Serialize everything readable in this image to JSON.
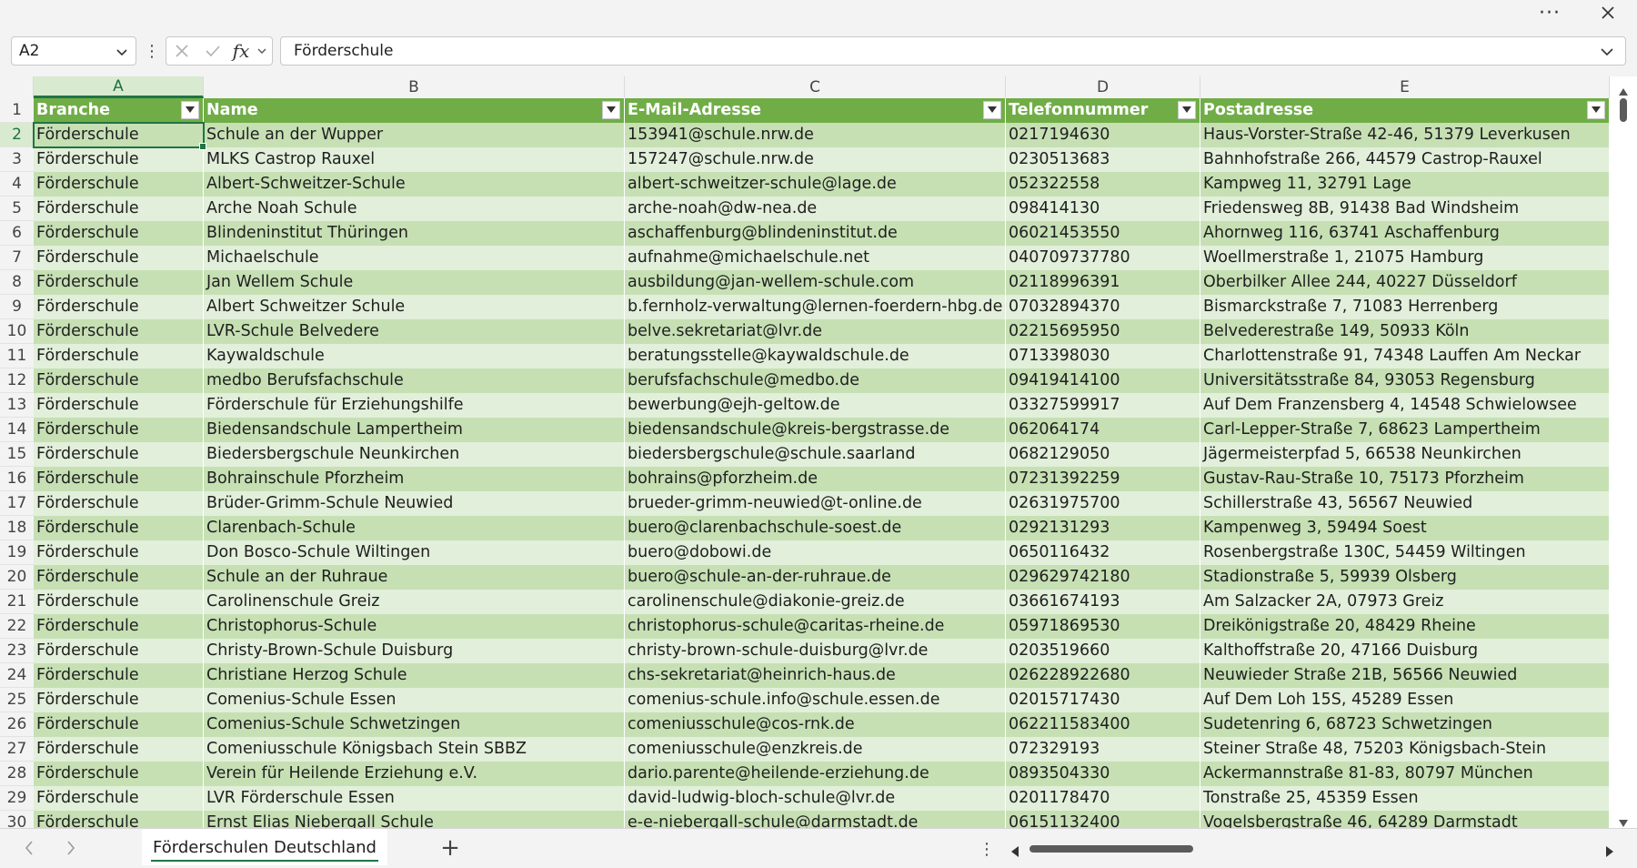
{
  "window": {
    "more_icon": "more-horizontal-icon",
    "close_icon": "close-icon"
  },
  "formula_bar": {
    "name_box": "A2",
    "formula": "Förderschule",
    "fx_label": "fx"
  },
  "columns": [
    "A",
    "B",
    "C",
    "D",
    "E"
  ],
  "header_row": {
    "number": "1",
    "cells": [
      "Branche",
      "Name",
      "E-Mail-Adresse",
      "Telefonnummer",
      "Postadresse"
    ]
  },
  "rows": [
    {
      "n": "2",
      "cells": [
        "Förderschule",
        "Schule an der Wupper",
        "153941@schule.nrw.de",
        "0217194630",
        "Haus-Vorster-Straße 42-46, 51379 Leverkusen"
      ]
    },
    {
      "n": "3",
      "cells": [
        "Förderschule",
        "MLKS Castrop Rauxel",
        "157247@schule.nrw.de",
        "0230513683",
        "Bahnhofstraße 266, 44579 Castrop-Rauxel"
      ]
    },
    {
      "n": "4",
      "cells": [
        "Förderschule",
        "Albert-Schweitzer-Schule",
        "albert-schweitzer-schule@lage.de",
        "052322558",
        "Kampweg 11, 32791 Lage"
      ]
    },
    {
      "n": "5",
      "cells": [
        "Förderschule",
        "Arche Noah Schule",
        "arche-noah@dw-nea.de",
        "098414130",
        "Friedensweg 8B, 91438 Bad Windsheim"
      ]
    },
    {
      "n": "6",
      "cells": [
        "Förderschule",
        "Blindeninstitut Thüringen",
        "aschaffenburg@blindeninstitut.de",
        "06021453550",
        "Ahornweg 116, 63741 Aschaffenburg"
      ]
    },
    {
      "n": "7",
      "cells": [
        "Förderschule",
        "Michaelschule",
        "aufnahme@michaelschule.net",
        "040709737780",
        "Woellmerstraße 1, 21075 Hamburg"
      ]
    },
    {
      "n": "8",
      "cells": [
        "Förderschule",
        "Jan Wellem Schule",
        "ausbildung@jan-wellem-schule.com",
        "02118996391",
        "Oberbilker Allee 244, 40227 Düsseldorf"
      ]
    },
    {
      "n": "9",
      "cells": [
        "Förderschule",
        "Albert Schweitzer Schule",
        "b.fernholz-verwaltung@lernen-foerdern-hbg.de",
        "07032894370",
        "Bismarckstraße 7, 71083 Herrenberg"
      ]
    },
    {
      "n": "10",
      "cells": [
        "Förderschule",
        "LVR-Schule Belvedere",
        "belve.sekretariat@lvr.de",
        "02215695950",
        "Belvederestraße 149, 50933 Köln"
      ]
    },
    {
      "n": "11",
      "cells": [
        "Förderschule",
        "Kaywaldschule",
        "beratungsstelle@kaywaldschule.de",
        "0713398030",
        "Charlottenstraße 91, 74348 Lauffen Am Neckar"
      ]
    },
    {
      "n": "12",
      "cells": [
        "Förderschule",
        "medbo Berufsfachschule",
        "berufsfachschule@medbo.de",
        "09419414100",
        "Universitätsstraße 84, 93053 Regensburg"
      ]
    },
    {
      "n": "13",
      "cells": [
        "Förderschule",
        "Förderschule für Erziehungshilfe",
        "bewerbung@ejh-geltow.de",
        "03327599917",
        "Auf Dem Franzensberg 4, 14548 Schwielowsee"
      ]
    },
    {
      "n": "14",
      "cells": [
        "Förderschule",
        "Biedensandschule Lampertheim",
        "biedensandschule@kreis-bergstrasse.de",
        "062064174",
        "Carl-Lepper-Straße 7, 68623 Lampertheim"
      ]
    },
    {
      "n": "15",
      "cells": [
        "Förderschule",
        "Biedersbergschule Neunkirchen",
        "biedersbergschule@schule.saarland",
        "0682129050",
        "Jägermeisterpfad 5, 66538 Neunkirchen"
      ]
    },
    {
      "n": "16",
      "cells": [
        "Förderschule",
        "Bohrainschule Pforzheim",
        "bohrains@pforzheim.de",
        "07231392259",
        "Gustav-Rau-Straße 10, 75173 Pforzheim"
      ]
    },
    {
      "n": "17",
      "cells": [
        "Förderschule",
        "Brüder-Grimm-Schule Neuwied",
        "brueder-grimm-neuwied@t-online.de",
        "02631975700",
        "Schillerstraße 43, 56567 Neuwied"
      ]
    },
    {
      "n": "18",
      "cells": [
        "Förderschule",
        "Clarenbach-Schule",
        "buero@clarenbachschule-soest.de",
        "0292131293",
        "Kampenweg 3, 59494 Soest"
      ]
    },
    {
      "n": "19",
      "cells": [
        "Förderschule",
        "Don Bosco-Schule Wiltingen",
        "buero@dobowi.de",
        "0650116432",
        "Rosenbergstraße 130C, 54459 Wiltingen"
      ]
    },
    {
      "n": "20",
      "cells": [
        "Förderschule",
        "Schule an der Ruhraue",
        "buero@schule-an-der-ruhraue.de",
        "029629742180",
        "Stadionstraße 5, 59939 Olsberg"
      ]
    },
    {
      "n": "21",
      "cells": [
        "Förderschule",
        "Carolinenschule Greiz",
        "carolinenschule@diakonie-greiz.de",
        "03661674193",
        "Am Salzacker 2A, 07973 Greiz"
      ]
    },
    {
      "n": "22",
      "cells": [
        "Förderschule",
        "Christophorus-Schule",
        "christophorus-schule@caritas-rheine.de",
        "05971869530",
        "Dreikönigstraße 20, 48429 Rheine"
      ]
    },
    {
      "n": "23",
      "cells": [
        "Förderschule",
        "Christy-Brown-Schule Duisburg",
        "christy-brown-schule-duisburg@lvr.de",
        "0203519660",
        "Kalthoffstraße 20, 47166 Duisburg"
      ]
    },
    {
      "n": "24",
      "cells": [
        "Förderschule",
        "Christiane Herzog Schule",
        "chs-sekretariat@heinrich-haus.de",
        "026228922680",
        "Neuwieder Straße 21B, 56566 Neuwied"
      ]
    },
    {
      "n": "25",
      "cells": [
        "Förderschule",
        "Comenius-Schule Essen",
        "comenius-schule.info@schule.essen.de",
        "02015717430",
        "Auf Dem Loh 15S, 45289 Essen"
      ]
    },
    {
      "n": "26",
      "cells": [
        "Förderschule",
        "Comenius-Schule Schwetzingen",
        "comeniusschule@cos-rnk.de",
        "062211583400",
        "Sudetenring 6, 68723 Schwetzingen"
      ]
    },
    {
      "n": "27",
      "cells": [
        "Förderschule",
        "Comeniusschule Königsbach Stein SBBZ",
        "comeniusschule@enzkreis.de",
        "072329193",
        "Steiner Straße 48, 75203 Königsbach-Stein"
      ]
    },
    {
      "n": "28",
      "cells": [
        "Förderschule",
        "Verein für Heilende Erziehung e.V.",
        "dario.parente@heilende-erziehung.de",
        "0893504330",
        "Ackermannstraße 81-83, 80797 München"
      ]
    },
    {
      "n": "29",
      "cells": [
        "Förderschule",
        "LVR Förderschule Essen",
        "david-ludwig-bloch-schule@lvr.de",
        "0201178470",
        "Tonstraße 25, 45359 Essen"
      ]
    },
    {
      "n": "30",
      "cells": [
        "Förderschule",
        "Ernst Elias Niebergall Schule",
        "e-e-niebergall-schule@darmstadt.de",
        "06151132400",
        "Vogelsbergstraße 46, 64289 Darmstadt"
      ]
    }
  ],
  "sheet_tabs": [
    "Förderschulen Deutschland"
  ],
  "add_sheet_label": "+",
  "colors": {
    "header_fill": "#70ad47",
    "band_dark": "#c6e0b4",
    "band_light": "#e2efda",
    "selection": "#217346"
  }
}
